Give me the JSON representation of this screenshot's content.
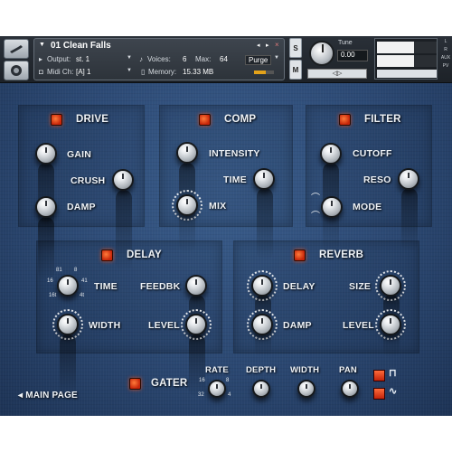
{
  "header": {
    "instrument_name": "01 Clean Falls",
    "output_label": "Output:",
    "output_value": "st. 1",
    "voices_label": "Voices:",
    "voices_value": "6",
    "max_label": "Max:",
    "max_value": "64",
    "purge_label": "Purge",
    "midi_label": "Midi Ch:",
    "midi_value": "[A]  1",
    "memory_label": "Memory:",
    "memory_value": "15.33 MB",
    "solo_label": "S",
    "mute_label": "M",
    "tune_label": "Tune",
    "tune_value": "0.00",
    "pan_label": "◁▷",
    "side_aux": "AUX",
    "side_pv": "PV",
    "side_l": "L",
    "side_r": "R",
    "colors": {
      "bar": "#2a3038",
      "accent": "#e3a21a"
    }
  },
  "drive": {
    "title": "DRIVE",
    "gain": "GAIN",
    "crush": "CRUSH",
    "damp": "DAMP"
  },
  "comp": {
    "title": "COMP",
    "intensity": "INTENSITY",
    "time": "TIME",
    "mix": "MIX"
  },
  "filter": {
    "title": "FILTER",
    "cutoff": "CUTOFF",
    "reso": "RESO",
    "mode": "MODE"
  },
  "delay": {
    "title": "DELAY",
    "time": "TIME",
    "feedbk": "FEEDBK",
    "width": "WIDTH",
    "level": "LEVEL",
    "time_ticks": [
      "81",
      "8",
      "16",
      "41",
      "16t",
      "4t"
    ]
  },
  "reverb": {
    "title": "REVERB",
    "delay": "DELAY",
    "size": "SIZE",
    "damp": "DAMP",
    "level": "LEVEL"
  },
  "gater": {
    "title": "GATER",
    "rate": "RATE",
    "depth": "DEPTH",
    "width": "WIDTH",
    "pan": "PAN",
    "rate_ticks": [
      "16",
      "8",
      "32",
      "4"
    ],
    "wave_square_icon": "square-wave-icon",
    "wave_sine_icon": "sine-wave-icon"
  },
  "nav": {
    "main_page": "◂  MAIN PAGE"
  },
  "colors": {
    "led": "#e0401a",
    "panel_bg": "#2e4c78",
    "label": "#eef2f6"
  }
}
